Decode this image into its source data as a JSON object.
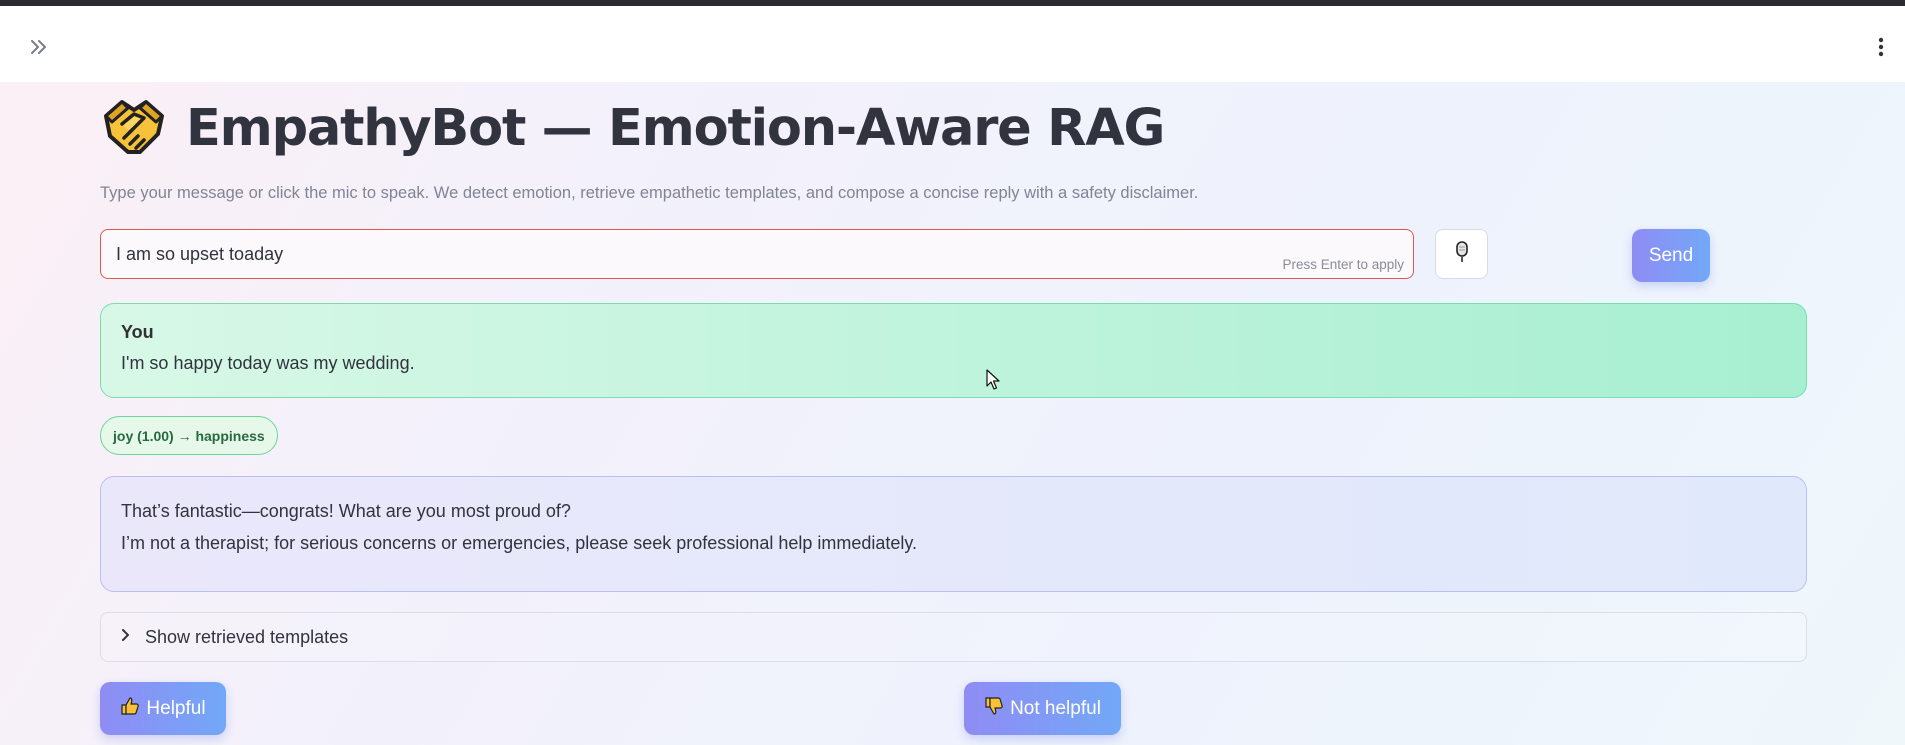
{
  "header": {
    "sidebar_toggle_icon": "double-chevron-right-icon",
    "menu_icon": "vertical-ellipsis-icon"
  },
  "page": {
    "title_icon": "handshake-emoji-icon",
    "title": "EmpathyBot — Emotion-Aware RAG",
    "subtitle": "Type your message or click the mic to speak. We detect emotion, retrieve empathetic templates, and compose a concise reply with a safety disclaimer."
  },
  "composer": {
    "input_value": "I am so upset toaday",
    "input_hint": "Press Enter to apply",
    "mic_icon": "microphone-icon",
    "send_label": "Send"
  },
  "conversation": {
    "user_label": "You",
    "user_message": "I'm so happy today was my wedding.",
    "emotion_tag": "joy (1.00) → happiness",
    "bot_reply_lines": [
      "That’s fantastic—congrats! What are you most proud of?",
      "I’m not a therapist; for serious concerns or emergencies, please seek professional help immediately."
    ]
  },
  "templates_expander": {
    "label": "Show retrieved templates",
    "icon": "chevron-right-icon",
    "expanded": false
  },
  "feedback": {
    "helpful_label": "Helpful",
    "helpful_icon": "thumbs-up-icon",
    "not_helpful_label": "Not helpful",
    "not_helpful_icon": "thumbs-down-icon"
  },
  "colors": {
    "accent_gradient_start": "#8f8cf4",
    "accent_gradient_end": "#72a8f7",
    "user_card": "#a7efd1",
    "bot_card": "#e0e9fb",
    "emotion_chip_border": "#6fd49a",
    "input_border_error": "#e2574c"
  }
}
